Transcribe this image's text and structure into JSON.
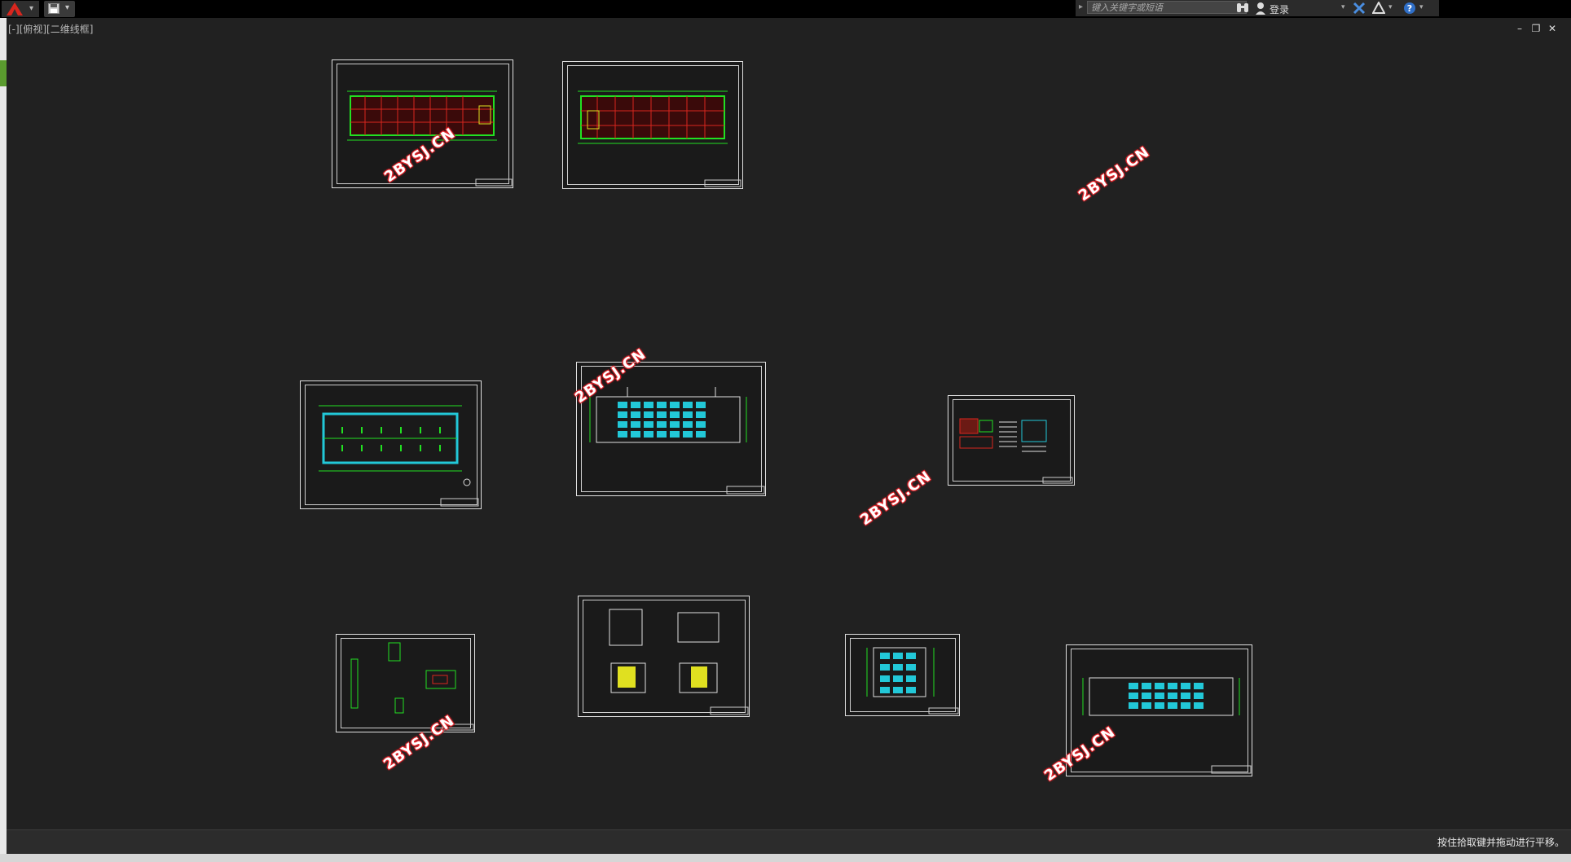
{
  "app": {
    "logo_icon": "autocad-a-icon",
    "menu_arrow": "▾",
    "quick_access_dropdown": "▾"
  },
  "infocenter": {
    "search_placeholder": "键入关键字或短语",
    "login_label": "登录",
    "dropdown": "▾"
  },
  "viewport": {
    "label": "[-][俯视][二维线框]",
    "win_minimize": "–",
    "win_restore": "❐",
    "win_close": "✕"
  },
  "watermarks": [
    "2BYSJ.CN",
    "2BYSJ.CN",
    "2BYSJ.CN",
    "2BYSJ.CN",
    "2BYSJ.CN",
    "2BYSJ.CN"
  ],
  "status": {
    "message": "按住拾取键并拖动进行平移。"
  },
  "colors": {
    "background": "#212121",
    "green": "#22e022",
    "red": "#d8261e",
    "cyan": "#22c8d8",
    "yellow": "#e0e020",
    "white": "#e0e0e0"
  }
}
